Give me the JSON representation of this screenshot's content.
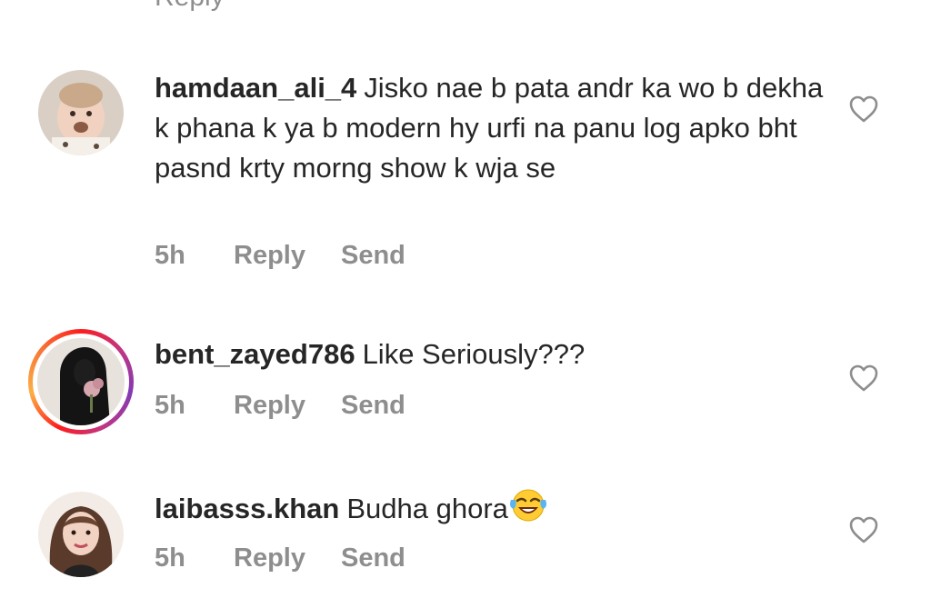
{
  "top_fragment": "Reply",
  "comments": [
    {
      "username": "hamdaan_ali_4",
      "text": "Jisko nae b pata andr ka wo b dekha k phana k ya b modern hy urfi na panu log apko bht pasnd krty morng show k wja se",
      "time": "5h",
      "reply_label": "Reply",
      "send_label": "Send",
      "has_story_ring": false
    },
    {
      "username": "bent_zayed786",
      "text": "Like Seriously???",
      "time": "5h",
      "reply_label": "Reply",
      "send_label": "Send",
      "has_story_ring": true
    },
    {
      "username": "laibasss.khan",
      "text": "Budha ghora",
      "emoji": "face-with-tears-of-joy",
      "time": "5h",
      "reply_label": "Reply",
      "send_label": "Send",
      "has_story_ring": false
    }
  ],
  "colors": {
    "text": "#262626",
    "meta": "#8e8e8e",
    "heart": "#8e8e8e"
  }
}
